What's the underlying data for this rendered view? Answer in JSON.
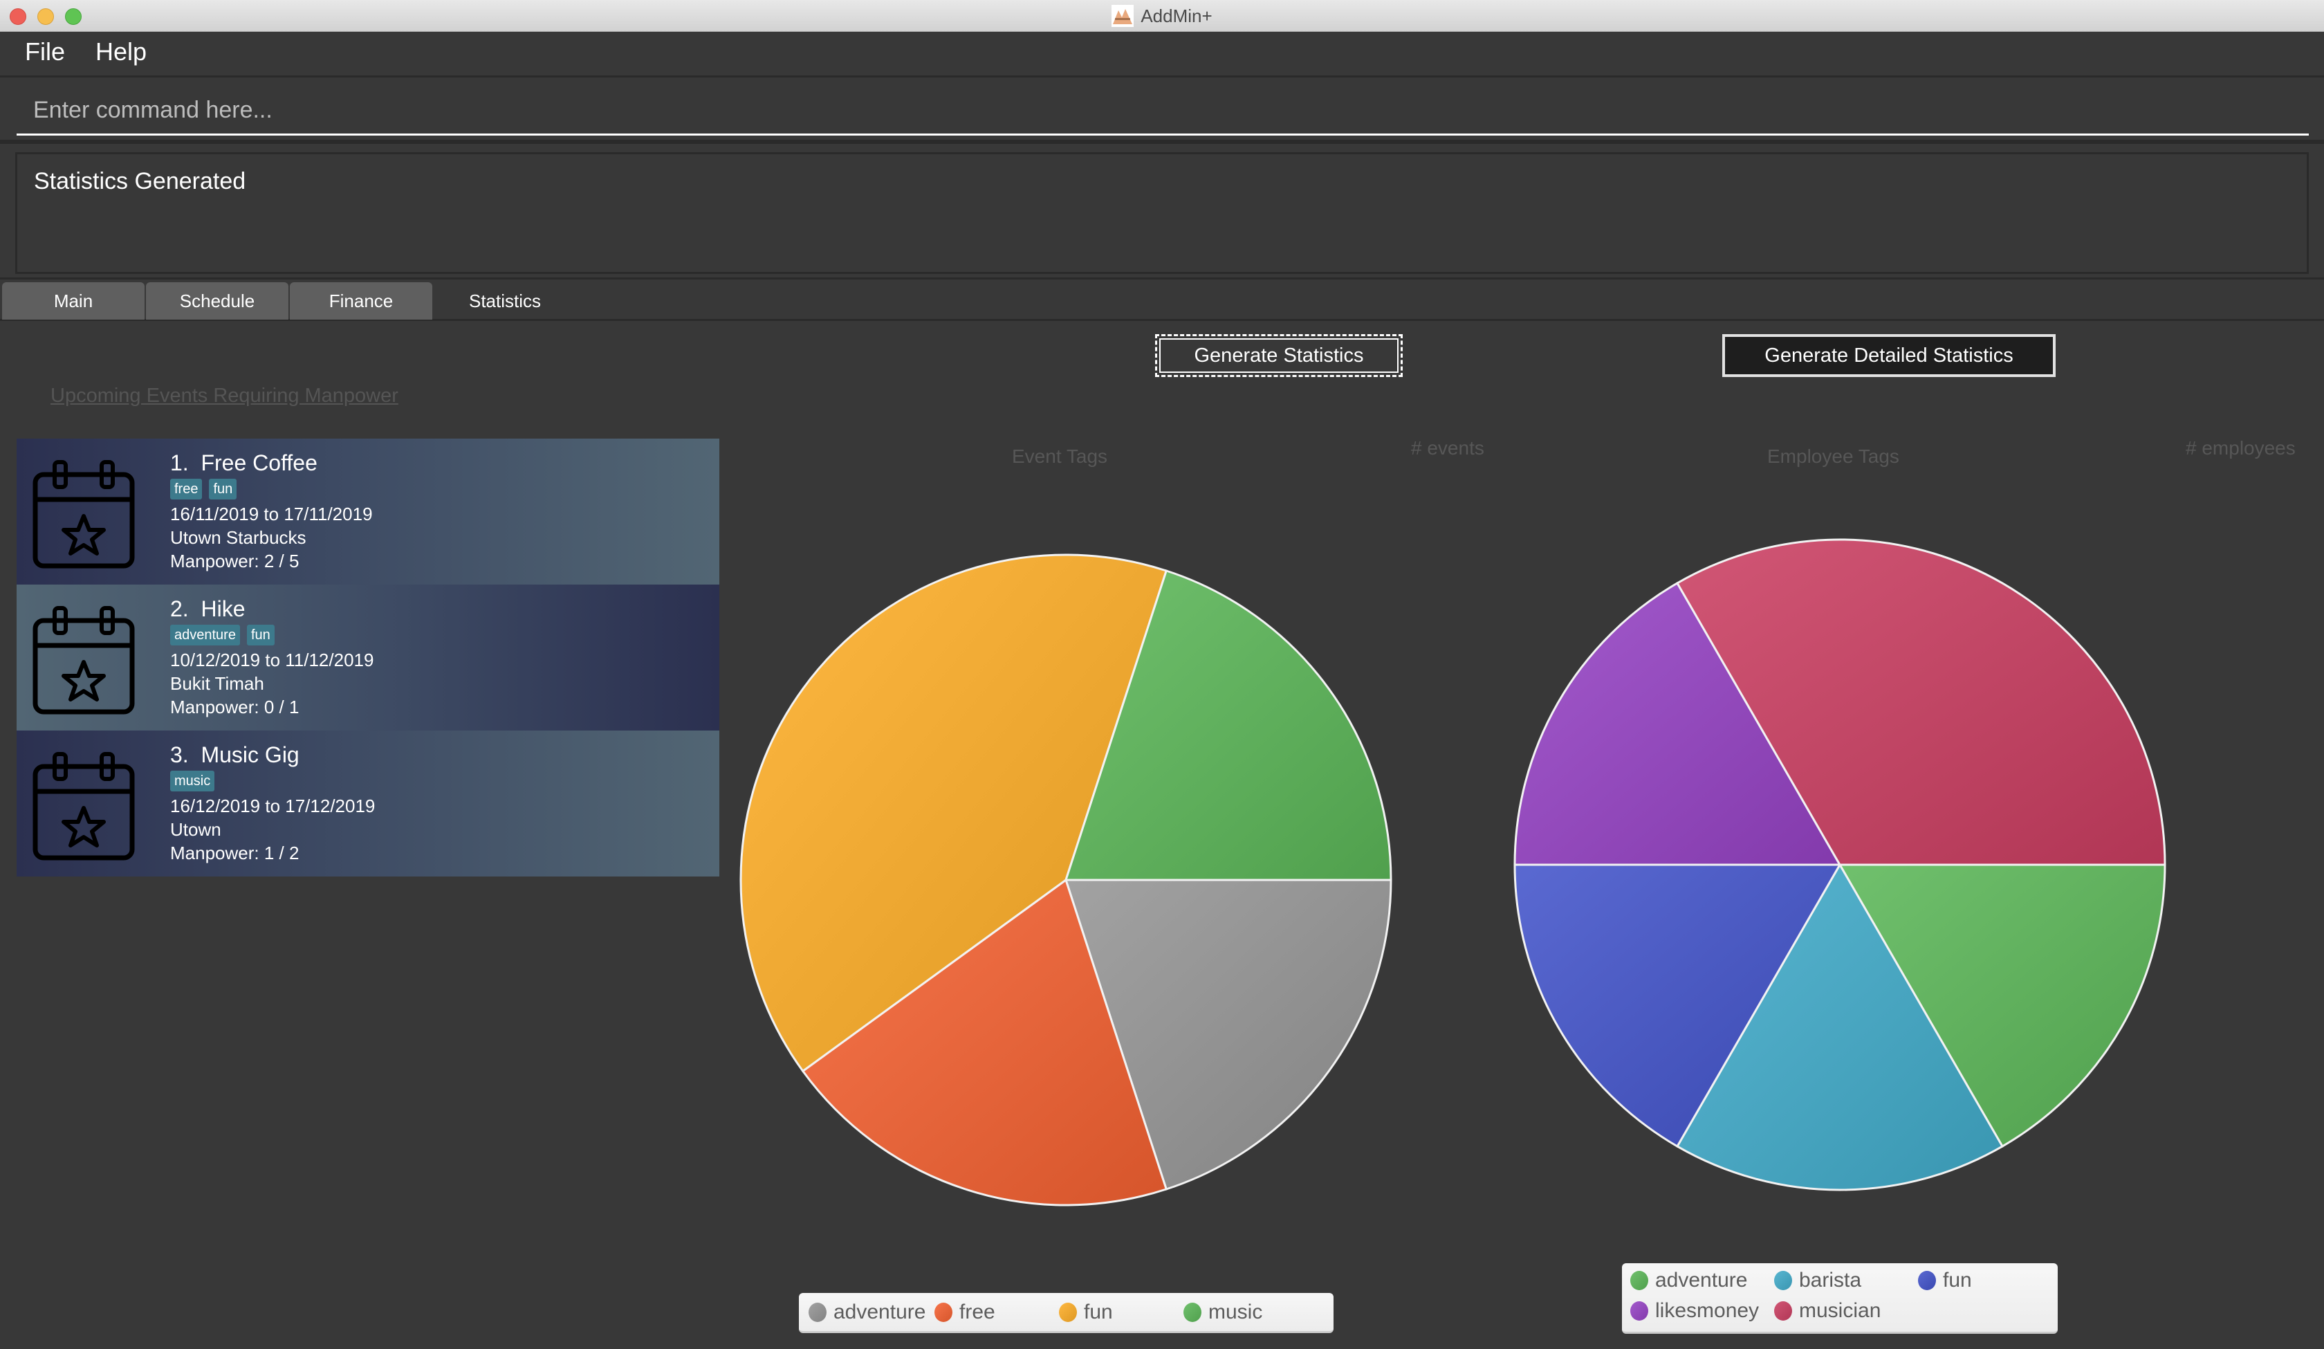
{
  "window": {
    "title": "AddMin+"
  },
  "menu": {
    "file": "File",
    "help": "Help"
  },
  "command": {
    "placeholder": "Enter command here...",
    "value": ""
  },
  "result": {
    "text": "Statistics Generated"
  },
  "tabs": [
    {
      "label": "Main",
      "active": false
    },
    {
      "label": "Schedule",
      "active": false
    },
    {
      "label": "Finance",
      "active": false
    },
    {
      "label": "Statistics",
      "active": true
    }
  ],
  "statistics": {
    "upcoming_label": "Upcoming Events Requiring Manpower",
    "generate_button": "Generate Statistics",
    "generate_detailed_button": "Generate Detailed Statistics"
  },
  "events": [
    {
      "index": "1.",
      "name": "Free Coffee",
      "tags": [
        "free",
        "fun"
      ],
      "dates": "16/11/2019 to 17/11/2019",
      "venue": "Utown Starbucks",
      "manpower": "Manpower: 2 / 5"
    },
    {
      "index": "2.",
      "name": "Hike",
      "tags": [
        "adventure",
        "fun"
      ],
      "dates": "10/12/2019 to 11/12/2019",
      "venue": "Bukit Timah",
      "manpower": "Manpower: 0 / 1"
    },
    {
      "index": "3.",
      "name": "Music Gig",
      "tags": [
        "music"
      ],
      "dates": "16/12/2019 to 17/12/2019",
      "venue": "Utown",
      "manpower": "Manpower: 1 / 2"
    }
  ],
  "chart_data": [
    {
      "type": "pie",
      "title": "Event Tags",
      "ylabel": "# events",
      "categories": [
        "adventure",
        "free",
        "fun",
        "music"
      ],
      "values": [
        1,
        1,
        2,
        1
      ],
      "colors": [
        "#8c8c8c",
        "#e05f35",
        "#e8a22c",
        "#5aaa57"
      ],
      "legend": "bottom"
    },
    {
      "type": "pie",
      "title": "Employee Tags",
      "ylabel": "# employees",
      "categories": [
        "adventure",
        "barista",
        "fun",
        "likesmoney",
        "musician"
      ],
      "values": [
        1,
        1,
        1,
        1,
        2
      ],
      "colors": [
        "#5aaa57",
        "#43a0bb",
        "#4453bb",
        "#8d44b6",
        "#bb405f"
      ],
      "legend": "bottom"
    }
  ]
}
